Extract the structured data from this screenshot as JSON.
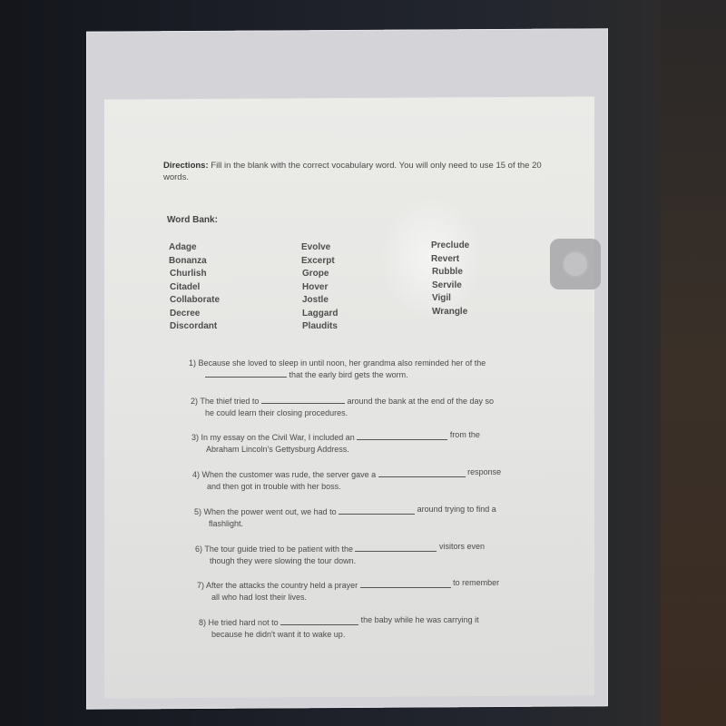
{
  "document": {
    "directions_label": "Directions:",
    "directions_text": " Fill in the blank with the correct vocabulary word.  You will only need to use 15 of the 20 words.",
    "word_bank_title": "Word Bank:",
    "word_bank": {
      "column1": [
        "Adage",
        "Bonanza",
        "Churlish",
        "Citadel",
        "Collaborate",
        "Decree",
        "Discordant"
      ],
      "column2": [
        "Evolve",
        "Excerpt",
        "Grope",
        "Hover",
        "Jostle",
        "Laggard",
        "Plaudits"
      ],
      "column3": [
        "Preclude",
        "Revert",
        "Rubble",
        "Servile",
        "Vigil",
        "Wrangle"
      ]
    },
    "questions": [
      {
        "number": "1)",
        "before": "Because she loved to sleep in until noon, her grandma also reminded her of the",
        "after": "that the early bird gets the worm."
      },
      {
        "number": "2)",
        "before": "The thief tried to",
        "after": "around the bank at the end of the day so",
        "line2": "he could learn their closing procedures."
      },
      {
        "number": "3)",
        "before": "In my essay on the Civil War, I included an",
        "after": "from the",
        "line2": "Abraham Lincoln's Gettysburg Address."
      },
      {
        "number": "4)",
        "before": "When the customer was rude, the server gave a",
        "after": "response",
        "line2": "and then got in trouble with her boss."
      },
      {
        "number": "5)",
        "before": "When the power went out, we had to",
        "after": "around trying to find a",
        "line2": "flashlight."
      },
      {
        "number": "6)",
        "before": "The tour guide tried to be patient with the",
        "after": "visitors even",
        "line2": "though they were slowing the tour down."
      },
      {
        "number": "7)",
        "before": "After the attacks the country held a prayer",
        "after": "to remember",
        "line2": "all who had lost their lives."
      },
      {
        "number": "8)",
        "before": "He tried hard not to",
        "after": "the baby while he was carrying it",
        "line2": "because he didn't want it to wake up."
      }
    ]
  },
  "overlay": {
    "assistive_touch_icon": "assistive-touch-button"
  }
}
